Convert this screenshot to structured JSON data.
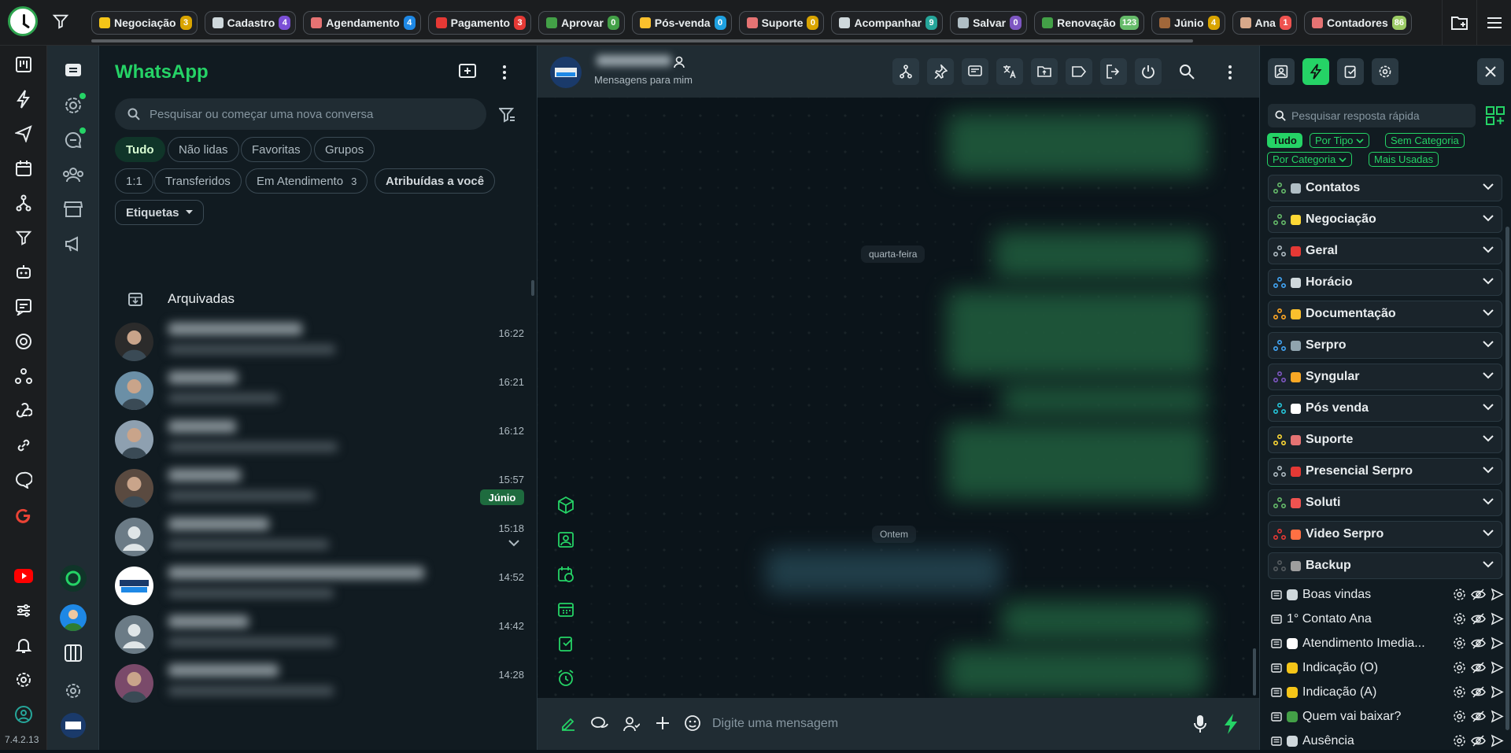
{
  "topbar": {
    "tags": [
      {
        "label": "Negociação",
        "count": "3",
        "emoji_color": "#f5c518",
        "count_color": "#d9a400"
      },
      {
        "label": "Cadastro",
        "count": "4",
        "emoji_color": "#cfd8dc",
        "count_color": "#7b4fd6"
      },
      {
        "label": "Agendamento",
        "count": "4",
        "emoji_color": "#e57373",
        "count_color": "#1e88e5"
      },
      {
        "label": "Pagamento",
        "count": "3",
        "emoji_color": "#e53935",
        "count_color": "#e53935"
      },
      {
        "label": "Aprovar",
        "count": "0",
        "emoji_color": "#43a047",
        "count_color": "#43a047"
      },
      {
        "label": "Pós-venda",
        "count": "0",
        "emoji_color": "#fbc02d",
        "count_color": "#1ea0e0"
      },
      {
        "label": "Suporte",
        "count": "0",
        "emoji_color": "#e57373",
        "count_color": "#d9a400"
      },
      {
        "label": "Acompanhar",
        "count": "9",
        "emoji_color": "#cfd8dc",
        "count_color": "#26a69a"
      },
      {
        "label": "Salvar",
        "count": "0",
        "emoji_color": "#b0bec5",
        "count_color": "#7e57c2"
      },
      {
        "label": "Renovação",
        "count": "123",
        "emoji_color": "#43a047",
        "count_color": "#66bb6a"
      },
      {
        "label": "Júnio",
        "count": "4",
        "emoji_color": "#a1673a",
        "count_color": "#d9a400"
      },
      {
        "label": "Ana",
        "count": "1",
        "emoji_color": "#d7a88a",
        "count_color": "#ef5350"
      },
      {
        "label": "Contadores",
        "count": "86",
        "emoji_color": "#e57373",
        "count_color": "#9ccc65"
      }
    ]
  },
  "version": "7.4.2.13",
  "chatlist": {
    "title": "WhatsApp",
    "search_placeholder": "Pesquisar ou começar uma nova conversa",
    "filters_row1": [
      "Tudo",
      "Não lidas",
      "Favoritas",
      "Grupos"
    ],
    "filters_row2": [
      "1:1",
      "Transferidos",
      "Em Atendimento",
      "Atribuídas a você"
    ],
    "em_atendimento_count": "3",
    "etiquetas": "Etiquetas",
    "archived": "Arquivadas",
    "chats": [
      {
        "time": "16:22"
      },
      {
        "time": "16:21"
      },
      {
        "time": "16:12"
      },
      {
        "time": "15:57",
        "badge": "Júnio"
      },
      {
        "time": "15:18"
      },
      {
        "time": "14:52"
      },
      {
        "time": "14:42"
      },
      {
        "time": "14:28"
      }
    ]
  },
  "conversation": {
    "subtitle": "Mensagens para mim",
    "day1": "quarta-feira",
    "day2": "Ontem",
    "input_placeholder": "Digite uma mensagem"
  },
  "quick_responses": {
    "search_placeholder": "Pesquisar resposta rápida",
    "filters": [
      "Tudo",
      "Por Tipo",
      "Sem Categoria",
      "Por Categoria",
      "Mais Usadas"
    ],
    "categories": [
      {
        "label": "Contatos",
        "icon_color": "#b0bec5"
      },
      {
        "label": "Negociação",
        "icon_color": "#fdd835"
      },
      {
        "label": "Geral",
        "icon_color": "#e53935"
      },
      {
        "label": "Horácio",
        "icon_color": "#cfd8dc"
      },
      {
        "label": "Documentação",
        "icon_color": "#fbc02d"
      },
      {
        "label": "Serpro",
        "icon_color": "#90a4ae"
      },
      {
        "label": "Syngular",
        "icon_color": "#f9a825"
      },
      {
        "label": "Pós venda",
        "icon_color": "#ffffff"
      },
      {
        "label": "Suporte",
        "icon_color": "#e57373"
      },
      {
        "label": "Presencial Serpro",
        "icon_color": "#e53935"
      },
      {
        "label": "Soluti",
        "icon_color": "#ef5350"
      },
      {
        "label": "Video Serpro",
        "icon_color": "#ff7043"
      },
      {
        "label": "Backup",
        "icon_color": "#9e9e9e"
      }
    ],
    "tri_colors": [
      "#66bb6a",
      "#66bb6a",
      "#aebac1",
      "#42a5f5",
      "#ffa726",
      "#42a5f5",
      "#7e57c2",
      "#26c6da",
      "#fdd835",
      "#aebac1",
      "#66bb6a",
      "#e53935",
      "#555b5f"
    ],
    "items": [
      {
        "label": "Boas vindas",
        "icon_color": "#cfd8dc"
      },
      {
        "label": "1° Contato Ana",
        "icon_color": ""
      },
      {
        "label": "Atendimento Imedia...",
        "icon_color": "#ffffff"
      },
      {
        "label": "Indicação (O)",
        "icon_color": "#f5c518"
      },
      {
        "label": "Indicação (A)",
        "icon_color": "#f5c518"
      },
      {
        "label": "Quem vai baixar?",
        "icon_color": "#43a047"
      },
      {
        "label": "Ausência",
        "icon_color": "#cfd8dc"
      }
    ]
  },
  "colors": {
    "accent": "#25d366",
    "panel": "#111b21",
    "header": "#202c33"
  }
}
